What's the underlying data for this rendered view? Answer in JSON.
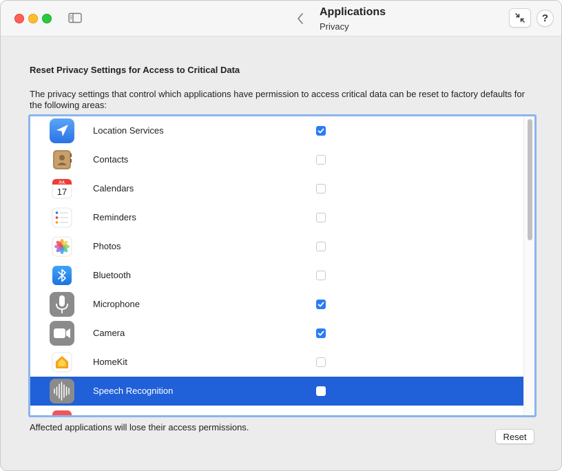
{
  "window": {
    "title": "Applications",
    "subtitle": "Privacy"
  },
  "toolbar": {
    "help_label": "?"
  },
  "panel": {
    "heading": "Reset Privacy Settings for Access to Critical Data",
    "description": "The privacy settings that control which applications have permission to access critical data can be reset to factory defaults for the following areas:",
    "footer_note": "Affected applications will lose their access permissions.",
    "reset_label": "Reset"
  },
  "calendar_icon": {
    "month": "JUL",
    "day": "17"
  },
  "colors": {
    "accent": "#2060d8",
    "checkbox_on": "#2a7cf6",
    "focus_ring": "#8cb4ec"
  },
  "items": [
    {
      "label": "Location Services",
      "icon": "location-services-icon",
      "checked": true
    },
    {
      "label": "Contacts",
      "icon": "contacts-icon",
      "checked": false
    },
    {
      "label": "Calendars",
      "icon": "calendar-icon",
      "checked": false
    },
    {
      "label": "Reminders",
      "icon": "reminders-icon",
      "checked": false
    },
    {
      "label": "Photos",
      "icon": "photos-icon",
      "checked": false
    },
    {
      "label": "Bluetooth",
      "icon": "bluetooth-icon",
      "checked": false
    },
    {
      "label": "Microphone",
      "icon": "microphone-icon",
      "checked": true
    },
    {
      "label": "Camera",
      "icon": "camera-icon",
      "checked": true
    },
    {
      "label": "HomeKit",
      "icon": "homekit-icon",
      "checked": false
    },
    {
      "label": "Speech Recognition",
      "icon": "speech-recognition-icon",
      "checked": false,
      "selected": true
    }
  ]
}
